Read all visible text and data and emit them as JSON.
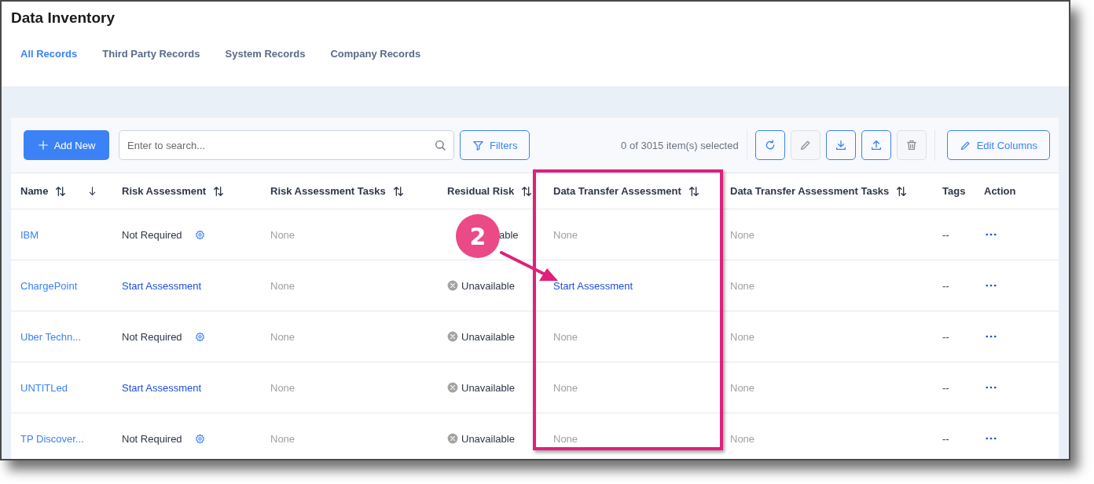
{
  "window": {
    "title": "Data Inventory"
  },
  "tabs": [
    {
      "label": "All Records",
      "selected": true
    },
    {
      "label": "Third Party Records",
      "selected": false
    },
    {
      "label": "System Records",
      "selected": false
    },
    {
      "label": "Company Records",
      "selected": false
    }
  ],
  "toolbar": {
    "add_button": "Add New",
    "search": {
      "placeholder": "Enter to search..."
    },
    "filters_button": "Filters",
    "selection_count": "0 of 3015 item(s) selected",
    "icon_buttons": [
      {
        "kind": "refresh",
        "disabled": false
      },
      {
        "kind": "edit",
        "disabled": true
      },
      {
        "kind": "download",
        "disabled": false
      },
      {
        "kind": "upload",
        "disabled": false
      },
      {
        "kind": "delete",
        "disabled": true
      }
    ],
    "edit_columns_button": "Edit Columns"
  },
  "table": {
    "columns": [
      {
        "label": "Name",
        "sortable": true,
        "sorted": true
      },
      {
        "label": "Risk Assessment",
        "sortable": true,
        "sorted": false
      },
      {
        "label": "Risk Assessment Tasks",
        "sortable": true,
        "sorted": false
      },
      {
        "label": "Residual Risk",
        "sortable": true,
        "sorted": false
      },
      {
        "label": "Data Transfer Assessment",
        "sortable": true,
        "sorted": false
      },
      {
        "label": "Data Transfer Assessment Tasks",
        "sortable": true,
        "sorted": false
      },
      {
        "label": "Tags",
        "sortable": false,
        "sorted": false
      },
      {
        "label": "Action",
        "sortable": false,
        "sorted": false
      }
    ],
    "rows": [
      {
        "name": "IBM",
        "risk_assessment": {
          "text": "Not Required",
          "kind": "status"
        },
        "risk_assessment_tasks": "None",
        "residual_risk": {
          "text": "able",
          "icon": false
        },
        "data_transfer_assessment": {
          "text": "None",
          "kind": "empty"
        },
        "data_transfer_assessment_tasks": "None",
        "tags": "--"
      },
      {
        "name": "ChargePoint",
        "risk_assessment": {
          "text": "Start Assessment",
          "kind": "link"
        },
        "risk_assessment_tasks": "None",
        "residual_risk": {
          "text": "Unavailable",
          "icon": true
        },
        "data_transfer_assessment": {
          "text": "Start Assessment",
          "kind": "link"
        },
        "data_transfer_assessment_tasks": "None",
        "tags": "--"
      },
      {
        "name": "Uber Techn...",
        "risk_assessment": {
          "text": "Not Required",
          "kind": "status"
        },
        "risk_assessment_tasks": "None",
        "residual_risk": {
          "text": "Unavailable",
          "icon": true
        },
        "data_transfer_assessment": {
          "text": "None",
          "kind": "empty"
        },
        "data_transfer_assessment_tasks": "None",
        "tags": "--"
      },
      {
        "name": "UNTITLed",
        "risk_assessment": {
          "text": "Start Assessment",
          "kind": "link"
        },
        "risk_assessment_tasks": "None",
        "residual_risk": {
          "text": "Unavailable",
          "icon": true
        },
        "data_transfer_assessment": {
          "text": "None",
          "kind": "empty"
        },
        "data_transfer_assessment_tasks": "None",
        "tags": "--"
      },
      {
        "name": "TP Discover...",
        "risk_assessment": {
          "text": "Not Required",
          "kind": "status"
        },
        "risk_assessment_tasks": "None",
        "residual_risk": {
          "text": "Unavailable",
          "icon": true
        },
        "data_transfer_assessment": {
          "text": "None",
          "kind": "empty"
        },
        "data_transfer_assessment_tasks": "None",
        "tags": "--"
      }
    ]
  },
  "annotation": {
    "step": "2"
  }
}
